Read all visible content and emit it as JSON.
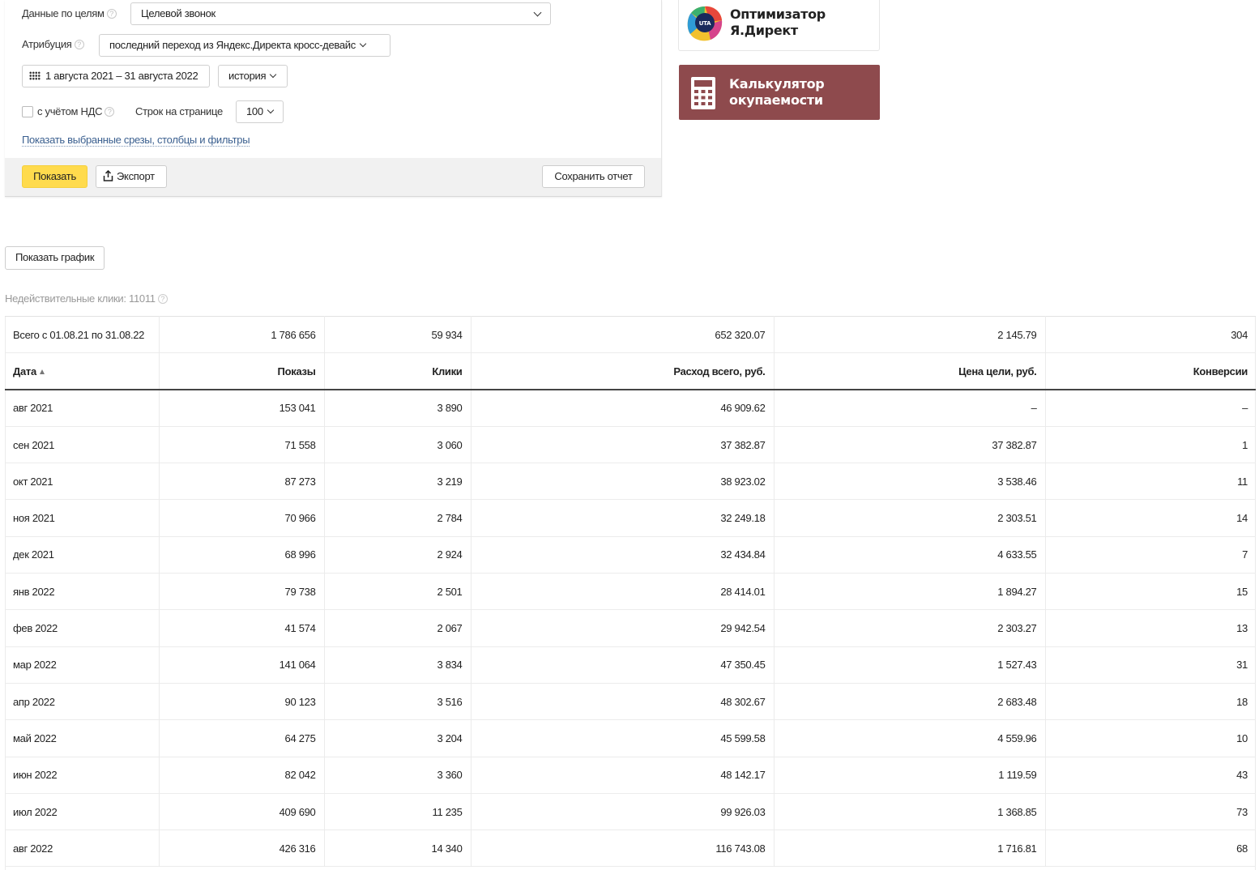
{
  "filters": {
    "goal_label": "Данные по целям",
    "goal_value": "Целевой звонок",
    "attribution_label": "Атрибуция",
    "attribution_value": "последний переход из Яндекс.Директа кросс-девайс",
    "date_range": "1 августа 2021 – 31 августа 2022",
    "group_value": "история",
    "vat_label": "с учётом НДС",
    "vat_checked": false,
    "rows_label": "Строк на странице",
    "rows_value": "100",
    "show_slices_link": "Показать выбранные срезы, столбцы и фильтры",
    "help_glyph": "?"
  },
  "actions": {
    "show_label": "Показать",
    "export_label": "Экспорт",
    "save_label": "Сохранить отчет"
  },
  "ads": {
    "optimizer_logo_text": "UTA",
    "optimizer_line1": "Оптимизатор",
    "optimizer_line2": "Я.Директ",
    "calculator_line1": "Калькулятор",
    "calculator_line2": "окупаемости",
    "calculator_color": "#8e4a4d"
  },
  "chart_button_label": "Показать график",
  "invalid_clicks_label": "Недействительные клики: 11011",
  "table": {
    "total": {
      "label": "Всего с 01.08.21 по 31.08.22",
      "impressions": "1 786 656",
      "clicks": "59 934",
      "spend": "652 320.07",
      "goal_price": "2 145.79",
      "conversions": "304"
    },
    "columns": {
      "date": "Дата",
      "impressions": "Показы",
      "clicks": "Клики",
      "spend": "Расход всего, руб.",
      "goal_price": "Цена цели, руб.",
      "conversions": "Конверсии"
    },
    "rows": [
      {
        "date": "авг 2021",
        "impressions": "153 041",
        "clicks": "3 890",
        "spend": "46 909.62",
        "goal_price": "–",
        "conversions": "–"
      },
      {
        "date": "сен 2021",
        "impressions": "71 558",
        "clicks": "3 060",
        "spend": "37 382.87",
        "goal_price": "37 382.87",
        "conversions": "1"
      },
      {
        "date": "окт 2021",
        "impressions": "87 273",
        "clicks": "3 219",
        "spend": "38 923.02",
        "goal_price": "3 538.46",
        "conversions": "11"
      },
      {
        "date": "ноя 2021",
        "impressions": "70 966",
        "clicks": "2 784",
        "spend": "32 249.18",
        "goal_price": "2 303.51",
        "conversions": "14"
      },
      {
        "date": "дек 2021",
        "impressions": "68 996",
        "clicks": "2 924",
        "spend": "32 434.84",
        "goal_price": "4 633.55",
        "conversions": "7"
      },
      {
        "date": "янв 2022",
        "impressions": "79 738",
        "clicks": "2 501",
        "spend": "28 414.01",
        "goal_price": "1 894.27",
        "conversions": "15"
      },
      {
        "date": "фев 2022",
        "impressions": "41 574",
        "clicks": "2 067",
        "spend": "29 942.54",
        "goal_price": "2 303.27",
        "conversions": "13"
      },
      {
        "date": "мар 2022",
        "impressions": "141 064",
        "clicks": "3 834",
        "spend": "47 350.45",
        "goal_price": "1 527.43",
        "conversions": "31"
      },
      {
        "date": "апр 2022",
        "impressions": "90 123",
        "clicks": "3 516",
        "spend": "48 302.67",
        "goal_price": "2 683.48",
        "conversions": "18"
      },
      {
        "date": "май 2022",
        "impressions": "64 275",
        "clicks": "3 204",
        "spend": "45 599.58",
        "goal_price": "4 559.96",
        "conversions": "10"
      },
      {
        "date": "июн 2022",
        "impressions": "82 042",
        "clicks": "3 360",
        "spend": "48 142.17",
        "goal_price": "1 119.59",
        "conversions": "43"
      },
      {
        "date": "июл 2022",
        "impressions": "409 690",
        "clicks": "11 235",
        "spend": "99 926.03",
        "goal_price": "1 368.85",
        "conversions": "73"
      },
      {
        "date": "авг 2022",
        "impressions": "426 316",
        "clicks": "14 340",
        "spend": "116 743.08",
        "goal_price": "1 716.81",
        "conversions": "68"
      }
    ]
  },
  "colors": {
    "accent_button": "#ffdb4d",
    "link": "#3a5f8f"
  }
}
